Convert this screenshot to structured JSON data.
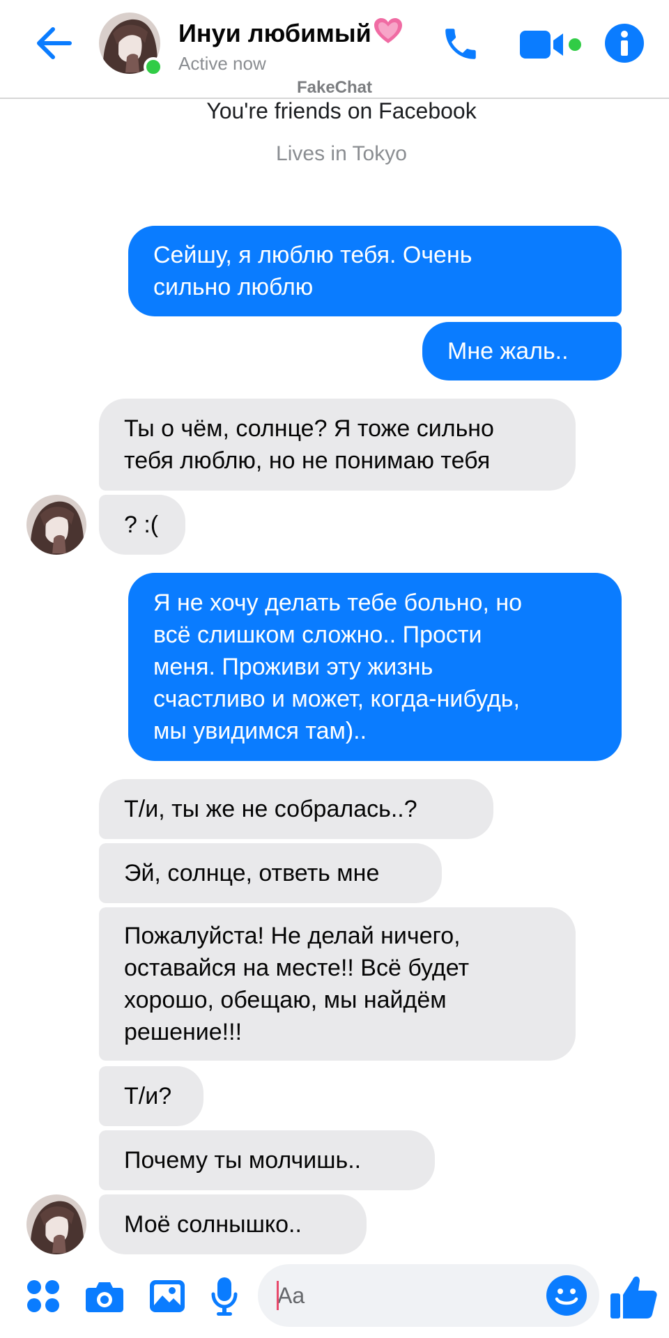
{
  "header": {
    "contact_name": "Инуи любимый",
    "status": "Active now",
    "watermark": "FakeChat"
  },
  "intro": {
    "friends_note": "You're friends on Facebook",
    "lives_in": "Lives in Tokyo"
  },
  "messages": [
    {
      "direction": "outgoing",
      "lines": [
        "Сейшу, я люблю тебя. Очень",
        "сильно люблю"
      ]
    },
    {
      "direction": "outgoing",
      "lines": [
        "Мне жаль.."
      ]
    },
    {
      "direction": "incoming",
      "lines": [
        "Ты о чём, солнце? Я тоже сильно",
        "тебя люблю, но не понимаю тебя"
      ]
    },
    {
      "direction": "incoming",
      "lines": [
        "? :("
      ]
    },
    {
      "direction": "outgoing",
      "lines": [
        "Я не хочу делать тебе больно, но",
        "всё слишком сложно.. Прости",
        "меня. Проживи эту жизнь",
        "счастливо и может, когда-нибудь,",
        "мы увидимся там).."
      ]
    },
    {
      "direction": "incoming",
      "lines": [
        "Т/и, ты же не собралась..?"
      ]
    },
    {
      "direction": "incoming",
      "lines": [
        "Эй, солнце, ответь мне"
      ]
    },
    {
      "direction": "incoming",
      "lines": [
        "Пожалуйста! Не делай ничего,",
        "оставайся на месте!! Всё будет",
        "хорошо, обещаю, мы найдём",
        "решение!!!"
      ]
    },
    {
      "direction": "incoming",
      "lines": [
        "Т/и?"
      ]
    },
    {
      "direction": "incoming",
      "lines": [
        "Почему ты молчишь.."
      ]
    },
    {
      "direction": "incoming",
      "lines": [
        "Моё солнышко.."
      ]
    }
  ],
  "composer": {
    "placeholder": "Aa"
  },
  "colors": {
    "accent": "#0a7cff",
    "outgoing_bubble": "#0a7cff",
    "incoming_bubble": "#e9e9eb",
    "online": "#31cc46",
    "heart": "#f06ba3"
  },
  "icons": [
    "back-arrow-icon",
    "phone-icon",
    "video-camera-icon",
    "info-icon",
    "heart-icon",
    "apps-icon",
    "camera-icon",
    "gallery-icon",
    "microphone-icon",
    "emoji-icon",
    "thumbs-up-icon"
  ]
}
